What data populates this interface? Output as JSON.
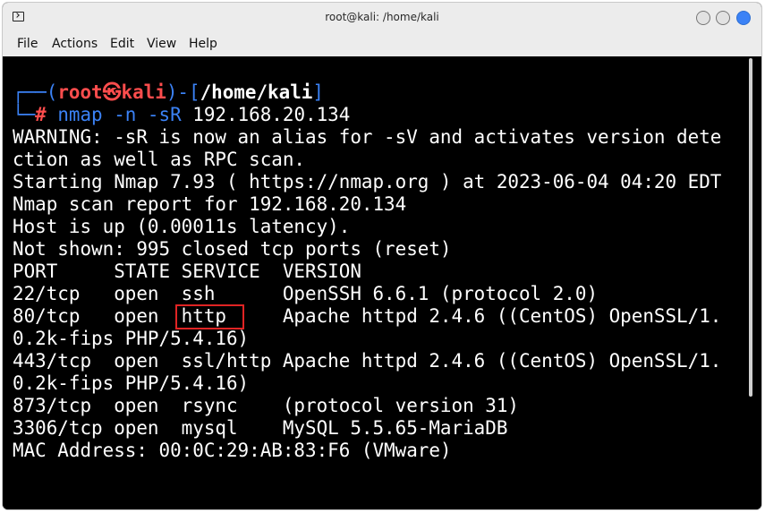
{
  "window": {
    "title": "root@kali: /home/kali"
  },
  "menu": {
    "file": "File",
    "actions": "Actions",
    "edit": "Edit",
    "view": "View",
    "help": "Help"
  },
  "prompt": {
    "corner_top": "┌──",
    "open_paren": "(",
    "user": "root",
    "at_symbol": "㉿",
    "host": "kali",
    "close_paren": ")",
    "dash_bracket_open": "-[",
    "path": "/home/kali",
    "bracket_close": "]",
    "corner_bottom": "└─",
    "hash": "#",
    "command_name": "nmap",
    "command_args": "-n -sR",
    "command_target": "192.168.20.134"
  },
  "output": {
    "line1": "WARNING: -sR is now an alias for -sV and activates version dete",
    "line2": "ction as well as RPC scan.",
    "line3": "Starting Nmap 7.93 ( https://nmap.org ) at 2023-06-04 04:20 EDT",
    "line4": "Nmap scan report for 192.168.20.134",
    "line5": "Host is up (0.00011s latency).",
    "line6": "Not shown: 995 closed tcp ports (reset)",
    "header": "PORT     STATE SERVICE  VERSION",
    "row22": "22/tcp   open  ssh      OpenSSH 6.6.1 (protocol 2.0)",
    "row80": "80/tcp   open  http     Apache httpd 2.4.6 ((CentOS) OpenSSL/1.",
    "row80_cont": "0.2k-fips PHP/5.4.16)",
    "row443": "443/tcp  open  ssl/http Apache httpd 2.4.6 ((CentOS) OpenSSL/1.",
    "row443_cont": "0.2k-fips PHP/5.4.16)",
    "row873": "873/tcp  open  rsync    (protocol version 31)",
    "row3306": "3306/tcp open  mysql    MySQL 5.5.65-MariaDB",
    "mac": "MAC Address: 00:0C:29:AB:83:F6 (VMware)"
  },
  "colors": {
    "prompt_blue": "#3b82f6",
    "prompt_red": "#ff4d4d",
    "highlight_red": "#e02424",
    "background": "#000000",
    "text": "#ffffff"
  },
  "icons": {
    "app": "terminal-icon",
    "minimize": "minimize-button",
    "maximize": "maximize-button",
    "close": "close-button"
  }
}
